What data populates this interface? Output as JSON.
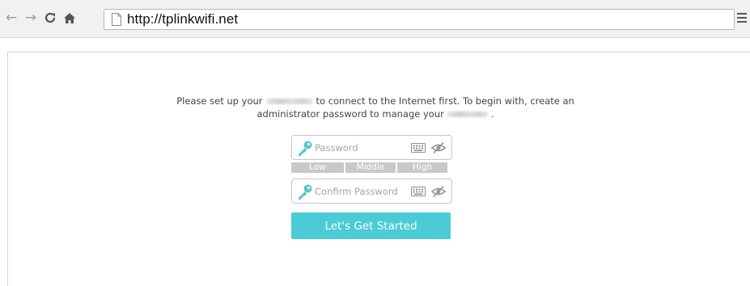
{
  "browser": {
    "back_glyph": "←",
    "forward_glyph": "→",
    "reload_glyph": "C",
    "home_glyph": "⌂",
    "url": "http://tplinkwifi.net"
  },
  "intro": {
    "line1_before": "Please set up your",
    "line1_after": "to connect to the Internet first. To begin with, create an",
    "line2_before": "administrator password to manage your",
    "line2_after": "."
  },
  "password_field": {
    "placeholder": "Password"
  },
  "strength": {
    "low": "Low",
    "middle": "Middle",
    "high": "High"
  },
  "confirm_field": {
    "placeholder": "Confirm Password"
  },
  "start_button": {
    "label": "Let's Get Started"
  },
  "colors": {
    "accent": "#4acbd6",
    "key_icon": "#59c4d6",
    "strength_bar": "#c9c9c9"
  },
  "icons": [
    "key-icon",
    "keyboard-icon",
    "eye-off-icon",
    "page-icon",
    "menu-icon"
  ]
}
